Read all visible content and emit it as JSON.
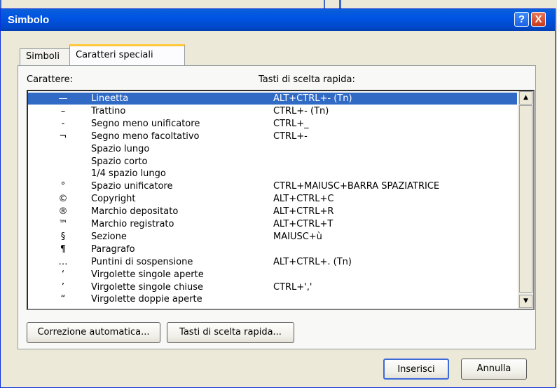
{
  "window": {
    "title": "Simbolo",
    "help_glyph": "?",
    "close_glyph": "X"
  },
  "tabs": [
    {
      "label": "Simboli",
      "selected": false
    },
    {
      "label": "Caratteri speciali",
      "selected": true
    }
  ],
  "columns": {
    "character": "Carattere:",
    "shortcut": "Tasti di scelta rapida:"
  },
  "rows": [
    {
      "char": "—",
      "name": "Lineetta",
      "shortcut": "ALT+CTRL+- (Tn)",
      "selected": true
    },
    {
      "char": "–",
      "name": "Trattino",
      "shortcut": "CTRL+- (Tn)"
    },
    {
      "char": "-",
      "name": "Segno meno unificatore",
      "shortcut": "CTRL+_"
    },
    {
      "char": "¬",
      "name": "Segno meno facoltativo",
      "shortcut": "CTRL+-"
    },
    {
      "char": "",
      "name": "Spazio lungo",
      "shortcut": ""
    },
    {
      "char": "",
      "name": "Spazio corto",
      "shortcut": ""
    },
    {
      "char": "",
      "name": "1/4  spazio lungo",
      "shortcut": ""
    },
    {
      "char": "°",
      "name": "Spazio unificatore",
      "shortcut": "CTRL+MAIUSC+BARRA SPAZIATRICE"
    },
    {
      "char": "©",
      "name": "Copyright",
      "shortcut": "ALT+CTRL+C"
    },
    {
      "char": "®",
      "name": "Marchio depositato",
      "shortcut": "ALT+CTRL+R"
    },
    {
      "char": "™",
      "name": "Marchio registrato",
      "shortcut": "ALT+CTRL+T"
    },
    {
      "char": "§",
      "name": "Sezione",
      "shortcut": "MAIUSC+ù"
    },
    {
      "char": "¶",
      "name": "Paragrafo",
      "shortcut": ""
    },
    {
      "char": "…",
      "name": "Puntini di sospensione",
      "shortcut": "ALT+CTRL+. (Tn)"
    },
    {
      "char": "‘",
      "name": "Virgolette singole aperte",
      "shortcut": ""
    },
    {
      "char": "’",
      "name": "Virgolette singole chiuse",
      "shortcut": "CTRL+','"
    },
    {
      "char": "“",
      "name": "Virgolette doppie aperte",
      "shortcut": ""
    }
  ],
  "scroll": {
    "up_glyph": "▲",
    "down_glyph": "▼"
  },
  "buttons": {
    "autocorrect": "Correzione automatica...",
    "shortcut_keys": "Tasti di scelta rapida...",
    "insert": "Inserisci",
    "cancel": "Annulla"
  },
  "colors": {
    "titlebar": "#0054e3",
    "selection": "#316ac5",
    "tab_accent": "#ffc83c"
  }
}
